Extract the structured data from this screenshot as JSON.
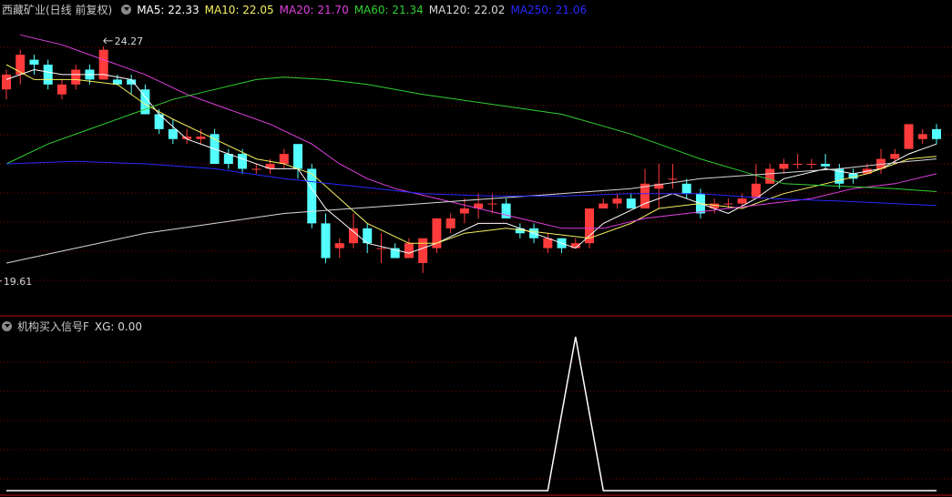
{
  "main_header": {
    "title": "西藏矿业(日线 前复权)",
    "indicators": [
      {
        "label": "MA5: 22.33",
        "color": "#ffffff"
      },
      {
        "label": "MA10: 22.05",
        "color": "#f5f060"
      },
      {
        "label": "MA20: 21.70",
        "color": "#e040e0"
      },
      {
        "label": "MA60: 21.34",
        "color": "#30d030"
      },
      {
        "label": "MA120: 22.02",
        "color": "#d8d8d8"
      },
      {
        "label": "MA250: 21.06",
        "color": "#2828ff"
      }
    ]
  },
  "sub_header": {
    "title": "机构买入信号F",
    "indicators": [
      {
        "label": "XG: 0.00",
        "color": "#d8d8d8"
      }
    ]
  },
  "annotations": {
    "high": "24.27",
    "low": "19.61"
  },
  "colors": {
    "up": "#ff3b3b",
    "down": "#54ffff",
    "grid": "#8b0000",
    "separator": "#c01010"
  },
  "chart_data": [
    {
      "type": "candlestick",
      "y_range": [
        19.0,
        24.8
      ],
      "annotated_high": 24.27,
      "annotated_low": 19.61,
      "candles": [
        [
          23.4,
          23.7,
          23.2,
          23.8
        ],
        [
          23.7,
          24.1,
          23.5,
          24.2
        ],
        [
          24.0,
          23.9,
          23.7,
          24.1
        ],
        [
          23.9,
          23.5,
          23.4,
          24.0
        ],
        [
          23.3,
          23.5,
          23.2,
          23.6
        ],
        [
          23.5,
          23.8,
          23.4,
          23.9
        ],
        [
          23.8,
          23.6,
          23.5,
          23.9
        ],
        [
          23.6,
          24.2,
          23.6,
          24.27
        ],
        [
          23.6,
          23.5,
          23.5,
          23.7
        ],
        [
          23.6,
          23.5,
          23.3,
          23.7
        ],
        [
          23.4,
          22.9,
          22.9,
          23.5
        ],
        [
          22.9,
          22.6,
          22.5,
          23.0
        ],
        [
          22.6,
          22.4,
          22.3,
          22.8
        ],
        [
          22.4,
          22.45,
          22.3,
          22.6
        ],
        [
          22.4,
          22.45,
          22.3,
          22.6
        ],
        [
          22.5,
          21.9,
          21.9,
          22.6
        ],
        [
          22.1,
          21.9,
          21.8,
          22.2
        ],
        [
          22.1,
          21.8,
          21.7,
          22.2
        ],
        [
          21.8,
          21.8,
          21.7,
          21.9
        ],
        [
          21.8,
          21.9,
          21.7,
          22.0
        ],
        [
          21.9,
          22.1,
          21.8,
          22.2
        ],
        [
          22.3,
          21.8,
          21.6,
          22.3
        ],
        [
          21.8,
          20.7,
          20.6,
          21.9
        ],
        [
          20.7,
          20.0,
          19.9,
          20.9
        ],
        [
          20.2,
          20.3,
          20.0,
          20.4
        ],
        [
          20.3,
          20.6,
          20.2,
          20.9
        ],
        [
          20.6,
          20.3,
          20.1,
          20.7
        ],
        [
          20.2,
          20.2,
          19.9,
          20.5
        ],
        [
          20.2,
          20.0,
          20.0,
          20.3
        ],
        [
          20.0,
          20.3,
          20.0,
          20.4
        ],
        [
          19.9,
          20.4,
          19.7,
          20.4
        ],
        [
          20.2,
          20.8,
          20.1,
          20.8
        ],
        [
          20.6,
          20.8,
          20.5,
          20.9
        ],
        [
          20.9,
          21.0,
          20.7,
          21.2
        ],
        [
          21.0,
          21.1,
          20.8,
          21.3
        ],
        [
          21.1,
          21.1,
          20.9,
          21.3
        ],
        [
          21.1,
          20.8,
          20.8,
          21.2
        ],
        [
          20.6,
          20.5,
          20.4,
          20.7
        ],
        [
          20.6,
          20.4,
          20.3,
          20.7
        ],
        [
          20.2,
          20.4,
          20.1,
          20.5
        ],
        [
          20.4,
          20.2,
          20.1,
          20.4
        ],
        [
          20.2,
          20.3,
          20.2,
          20.4
        ],
        [
          20.3,
          21.0,
          20.2,
          21.0
        ],
        [
          21.0,
          21.1,
          21.0,
          21.2
        ],
        [
          21.1,
          21.2,
          21.0,
          21.3
        ],
        [
          21.2,
          21.0,
          21.0,
          21.3
        ],
        [
          21.0,
          21.5,
          21.0,
          21.8
        ],
        [
          21.4,
          21.5,
          21.0,
          21.9
        ],
        [
          21.6,
          21.6,
          21.4,
          21.9
        ],
        [
          21.5,
          21.3,
          21.2,
          21.6
        ],
        [
          21.3,
          20.9,
          20.8,
          21.4
        ],
        [
          21.0,
          21.1,
          20.9,
          21.2
        ],
        [
          21.1,
          21.1,
          21.0,
          21.2
        ],
        [
          21.1,
          21.2,
          21.0,
          21.3
        ],
        [
          21.2,
          21.5,
          21.2,
          21.9
        ],
        [
          21.5,
          21.8,
          21.5,
          21.9
        ],
        [
          21.8,
          21.9,
          21.7,
          22.0
        ],
        [
          21.9,
          21.9,
          21.8,
          22.1
        ],
        [
          21.9,
          21.9,
          21.8,
          22.0
        ],
        [
          21.9,
          21.85,
          21.8,
          22.1
        ],
        [
          21.8,
          21.5,
          21.4,
          21.9
        ],
        [
          21.7,
          21.6,
          21.5,
          21.8
        ],
        [
          21.7,
          21.8,
          21.7,
          21.9
        ],
        [
          21.8,
          22.0,
          21.7,
          22.2
        ],
        [
          22.0,
          22.1,
          21.9,
          22.2
        ],
        [
          22.2,
          22.7,
          22.2,
          22.7
        ],
        [
          22.4,
          22.5,
          22.3,
          22.6
        ],
        [
          22.6,
          22.4,
          22.3,
          22.7
        ]
      ],
      "series": [
        {
          "name": "MA5",
          "color": "#ffffff",
          "points": [
            [
              0,
              23.6
            ],
            [
              2,
              23.8
            ],
            [
              4,
              23.7
            ],
            [
              7,
              23.7
            ],
            [
              9,
              23.6
            ],
            [
              11,
              22.9
            ],
            [
              13,
              22.4
            ],
            [
              16,
              22.1
            ],
            [
              19,
              21.8
            ],
            [
              21,
              21.8
            ],
            [
              23,
              21.0
            ],
            [
              26,
              20.3
            ],
            [
              29,
              20.1
            ],
            [
              31,
              20.3
            ],
            [
              34,
              20.7
            ],
            [
              36,
              20.7
            ],
            [
              38,
              20.5
            ],
            [
              41,
              20.2
            ],
            [
              43,
              20.7
            ],
            [
              46,
              21.1
            ],
            [
              48,
              21.3
            ],
            [
              50,
              21.1
            ],
            [
              52,
              20.9
            ],
            [
              54,
              21.2
            ],
            [
              56,
              21.6
            ],
            [
              59,
              21.8
            ],
            [
              61,
              21.7
            ],
            [
              63,
              21.8
            ],
            [
              65,
              22.1
            ],
            [
              67,
              22.3
            ]
          ]
        },
        {
          "name": "MA10",
          "color": "#f5f060",
          "points": [
            [
              0,
              23.9
            ],
            [
              2,
              23.6
            ],
            [
              5,
              23.6
            ],
            [
              8,
              23.5
            ],
            [
              10,
              23.1
            ],
            [
              12,
              22.8
            ],
            [
              15,
              22.4
            ],
            [
              18,
              22.0
            ],
            [
              20,
              21.9
            ],
            [
              22,
              21.7
            ],
            [
              24,
              21.2
            ],
            [
              26,
              20.7
            ],
            [
              29,
              20.3
            ],
            [
              31,
              20.3
            ],
            [
              33,
              20.5
            ],
            [
              36,
              20.6
            ],
            [
              39,
              20.5
            ],
            [
              42,
              20.4
            ],
            [
              45,
              20.7
            ],
            [
              47,
              21.0
            ],
            [
              50,
              21.1
            ],
            [
              53,
              21.0
            ],
            [
              56,
              21.3
            ],
            [
              59,
              21.5
            ],
            [
              62,
              21.7
            ],
            [
              65,
              22.0
            ],
            [
              67,
              22.05
            ]
          ]
        },
        {
          "name": "MA20",
          "color": "#e040e0",
          "points": [
            [
              1,
              24.5
            ],
            [
              4,
              24.3
            ],
            [
              7,
              24.0
            ],
            [
              10,
              23.7
            ],
            [
              13,
              23.3
            ],
            [
              16,
              23.0
            ],
            [
              19,
              22.7
            ],
            [
              22,
              22.3
            ],
            [
              24,
              21.9
            ],
            [
              26,
              21.6
            ],
            [
              28,
              21.4
            ],
            [
              31,
              21.2
            ],
            [
              34,
              21.0
            ],
            [
              37,
              20.8
            ],
            [
              40,
              20.6
            ],
            [
              43,
              20.6
            ],
            [
              46,
              20.8
            ],
            [
              49,
              20.9
            ],
            [
              52,
              21.0
            ],
            [
              55,
              21.1
            ],
            [
              58,
              21.2
            ],
            [
              61,
              21.4
            ],
            [
              64,
              21.5
            ],
            [
              67,
              21.7
            ]
          ]
        },
        {
          "name": "MA60",
          "color": "#30d030",
          "points": [
            [
              0,
              21.9
            ],
            [
              3,
              22.3
            ],
            [
              6,
              22.6
            ],
            [
              9,
              22.9
            ],
            [
              12,
              23.2
            ],
            [
              15,
              23.4
            ],
            [
              18,
              23.6
            ],
            [
              20,
              23.65
            ],
            [
              23,
              23.6
            ],
            [
              26,
              23.5
            ],
            [
              30,
              23.3
            ],
            [
              35,
              23.1
            ],
            [
              40,
              22.9
            ],
            [
              45,
              22.5
            ],
            [
              50,
              22.0
            ],
            [
              53,
              21.75
            ],
            [
              56,
              21.5
            ],
            [
              60,
              21.45
            ],
            [
              64,
              21.4
            ],
            [
              67,
              21.34
            ]
          ]
        },
        {
          "name": "MA120",
          "color": "#d8d8d8",
          "points": [
            [
              0,
              19.9
            ],
            [
              5,
              20.2
            ],
            [
              10,
              20.5
            ],
            [
              15,
              20.7
            ],
            [
              20,
              20.9
            ],
            [
              25,
              21.0
            ],
            [
              30,
              21.1
            ],
            [
              35,
              21.2
            ],
            [
              40,
              21.3
            ],
            [
              45,
              21.4
            ],
            [
              50,
              21.6
            ],
            [
              55,
              21.7
            ],
            [
              60,
              21.8
            ],
            [
              65,
              21.95
            ],
            [
              67,
              22.0
            ]
          ]
        },
        {
          "name": "MA250",
          "color": "#2828ff",
          "points": [
            [
              0,
              21.9
            ],
            [
              5,
              21.95
            ],
            [
              10,
              21.9
            ],
            [
              15,
              21.8
            ],
            [
              20,
              21.6
            ],
            [
              25,
              21.45
            ],
            [
              30,
              21.3
            ],
            [
              35,
              21.25
            ],
            [
              40,
              21.25
            ],
            [
              45,
              21.3
            ],
            [
              50,
              21.3
            ],
            [
              55,
              21.2
            ],
            [
              60,
              21.15
            ],
            [
              67,
              21.06
            ]
          ]
        }
      ]
    },
    {
      "type": "line",
      "series": [
        {
          "name": "XG",
          "color": "#ffffff",
          "points": [
            [
              0,
              0
            ],
            [
              39,
              0
            ],
            [
              41,
              1
            ],
            [
              43,
              0
            ],
            [
              67,
              0
            ]
          ]
        }
      ],
      "y_range": [
        0,
        1
      ]
    }
  ]
}
